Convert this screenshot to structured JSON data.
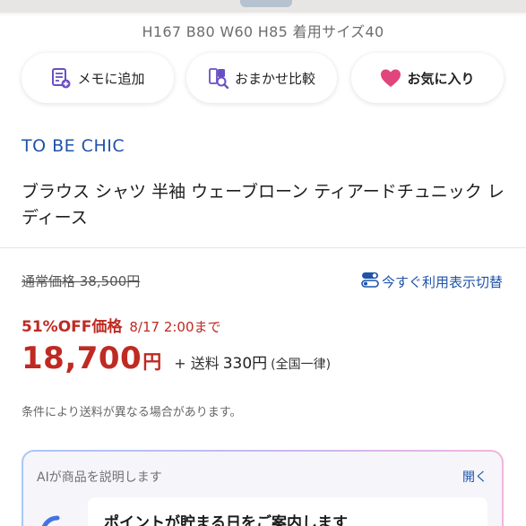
{
  "product": {
    "size_info": "H167 B80 W60 H85 着用サイズ40",
    "brand": "TO BE CHIC",
    "title": "ブラウス シャツ 半袖 ウェーブローン ティアードチュニック レディース"
  },
  "actions": {
    "memo_label": "メモに追加",
    "compare_label": "おまかせ比較",
    "favorite_label": "お気に入り"
  },
  "pricing": {
    "regular_price": "通常価格 38,500円",
    "toggle_label": "今すぐ利用表示切替",
    "discount": "51%OFF価格",
    "deadline": "8/17 2:00まで",
    "price": "18,700",
    "currency": "円",
    "shipping_label": "+ 送料",
    "shipping_fee": "330円",
    "shipping_note": "(全国一律)",
    "condition_note": "条件により送料が異なる場合があります。"
  },
  "ai_panel": {
    "header": "AIが商品を説明します",
    "open_label": "開く",
    "sub_title": "ポイントが貯まる日をご案内します"
  },
  "colors": {
    "brand_blue": "#1f53a8",
    "sale_red": "#bf2a23",
    "favorite_pink": "#e0457b",
    "icon_purple": "#6a4fc4"
  },
  "icons": {
    "memo": "memo-add-icon",
    "compare": "compare-search-icon",
    "favorite": "heart-icon",
    "toggle": "toggle-icon",
    "ai": "ai-logo-icon"
  }
}
